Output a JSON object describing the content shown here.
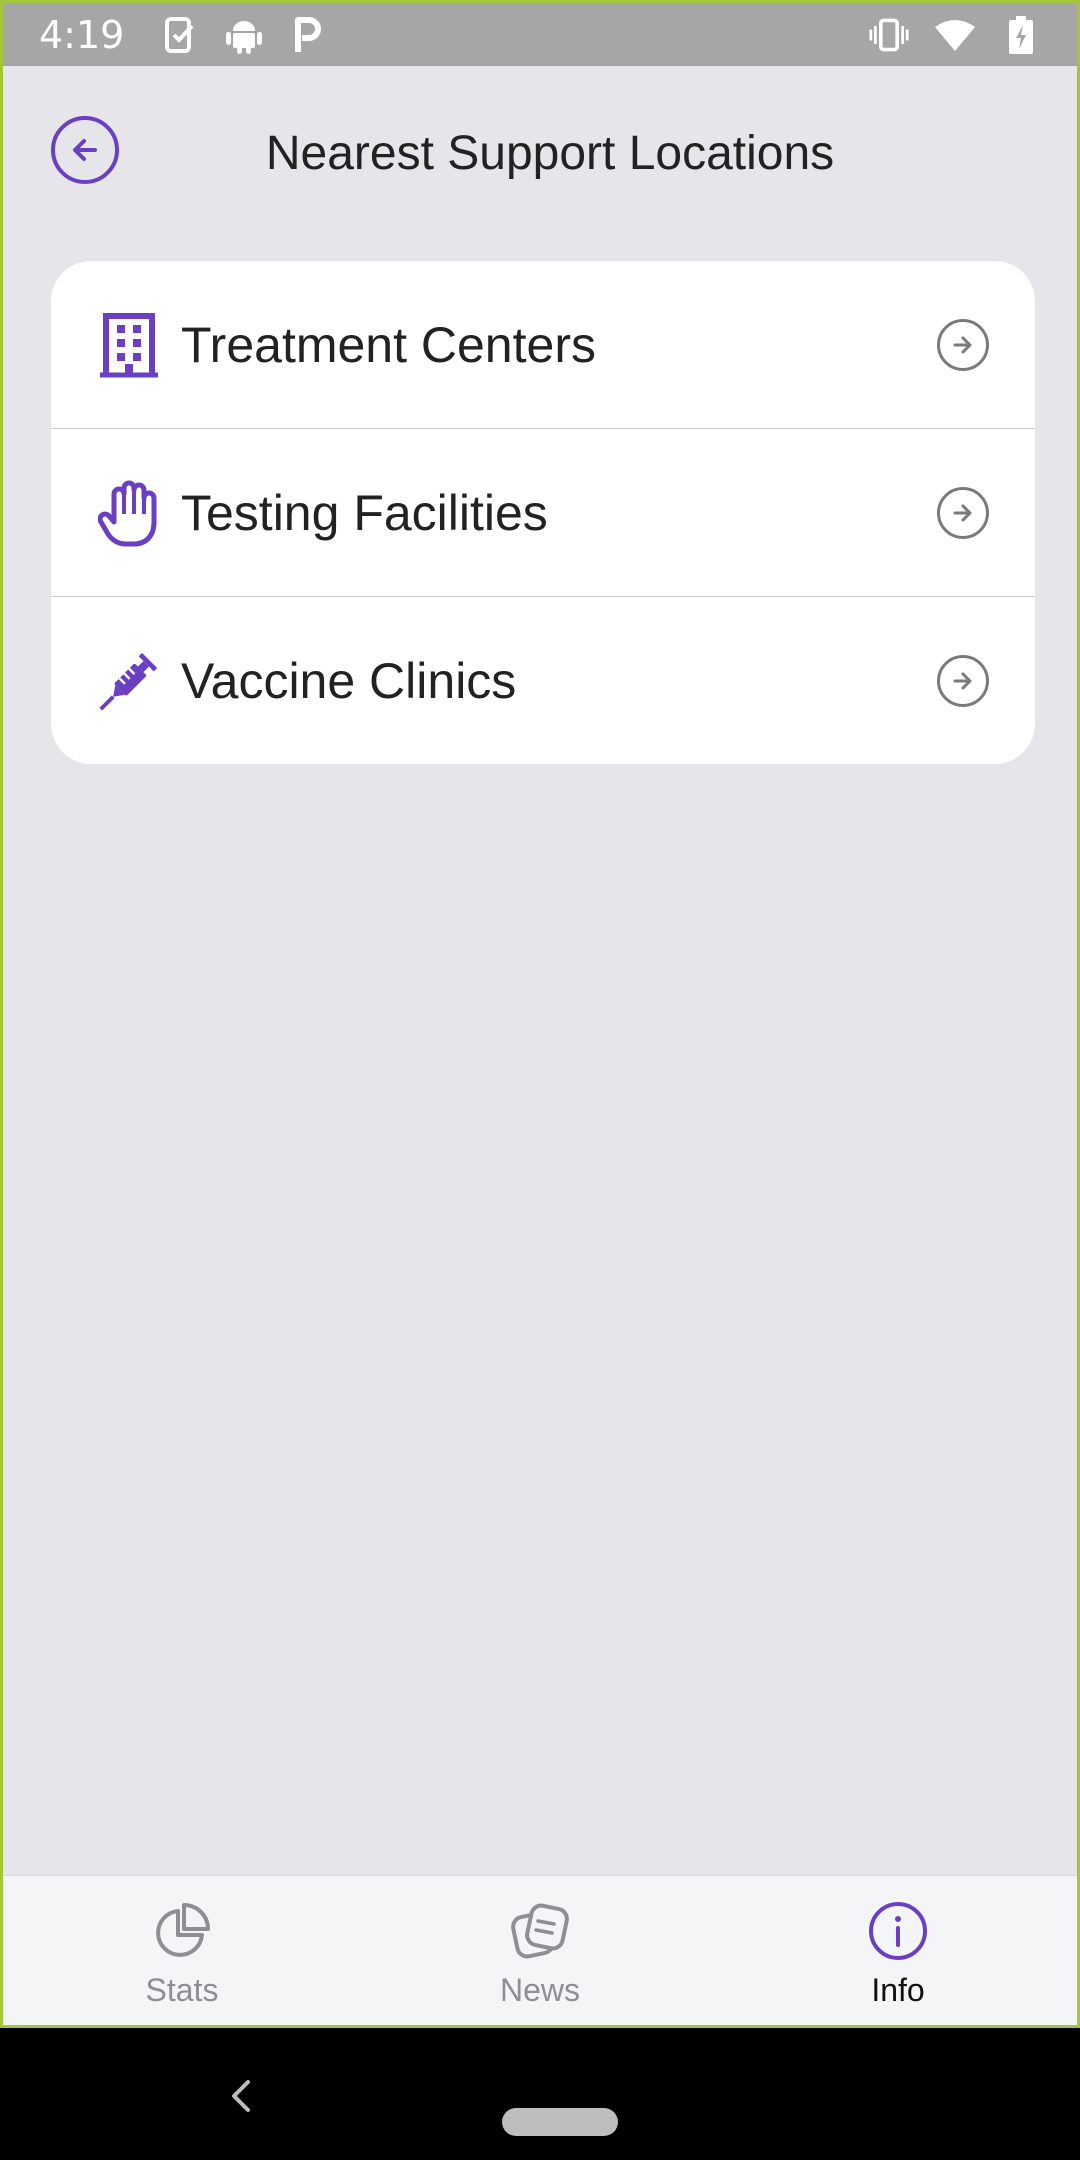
{
  "status_bar": {
    "time": "4:19",
    "left_icons": [
      "clipboard-check-icon",
      "android-icon",
      "parking-icon"
    ],
    "right_icons": [
      "vibrate-icon",
      "wifi-icon",
      "battery-charging-icon"
    ]
  },
  "header": {
    "title": "Nearest Support Locations",
    "back_icon": "arrow-left-circle-icon"
  },
  "locations": [
    {
      "label": "Treatment Centers",
      "icon": "building-icon"
    },
    {
      "label": "Testing Facilities",
      "icon": "hand-icon"
    },
    {
      "label": "Vaccine Clinics",
      "icon": "syringe-icon"
    }
  ],
  "bottom_nav": {
    "items": [
      {
        "label": "Stats",
        "icon": "pie-chart-icon"
      },
      {
        "label": "News",
        "icon": "news-icon"
      },
      {
        "label": "Info",
        "icon": "info-icon",
        "active": true
      }
    ]
  },
  "colors": {
    "accent": "#6a3fc1",
    "background": "#e5e5ea",
    "status_bar": "#a6a6a6"
  }
}
